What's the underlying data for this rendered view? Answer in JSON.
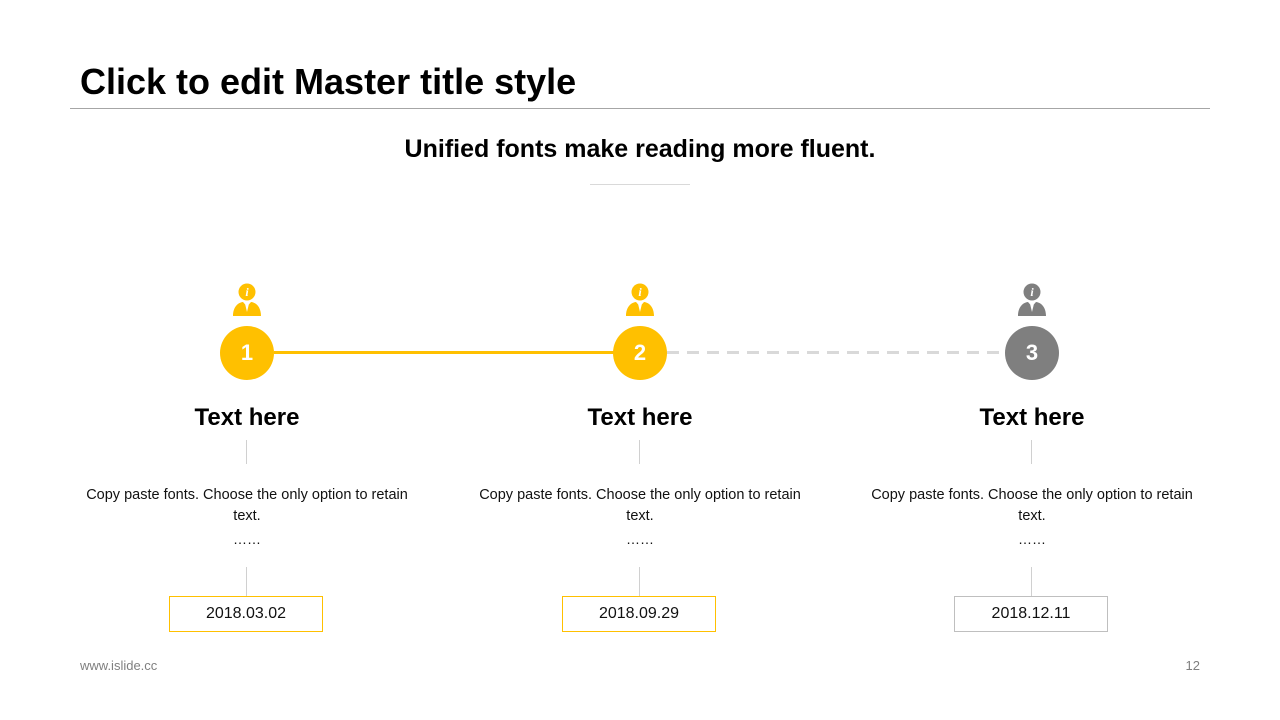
{
  "slide": {
    "title": "Click to edit Master title style",
    "subtitle": "Unified fonts make reading more fluent.",
    "footer_url": "www.islide.cc",
    "page_number": "12"
  },
  "colors": {
    "accent": "#FFC000",
    "inactive": "#7F7F7F",
    "inactive_border": "#BFBFBF",
    "dashed_line": "#D9D9D9"
  },
  "steps": [
    {
      "number": "1",
      "heading": "Text here",
      "description": "Copy paste fonts. Choose the only option to retain text.",
      "ellipsis": "……",
      "date": "2018.03.02",
      "icon": "info-person-icon",
      "state": "active"
    },
    {
      "number": "2",
      "heading": "Text here",
      "description": "Copy paste fonts. Choose the only option to retain text.",
      "ellipsis": "……",
      "date": "2018.09.29",
      "icon": "info-person-icon",
      "state": "active"
    },
    {
      "number": "3",
      "heading": "Text here",
      "description": "Copy paste fonts. Choose the only option to retain text.",
      "ellipsis": "……",
      "date": "2018.12.11",
      "icon": "info-person-icon",
      "state": "inactive"
    }
  ]
}
